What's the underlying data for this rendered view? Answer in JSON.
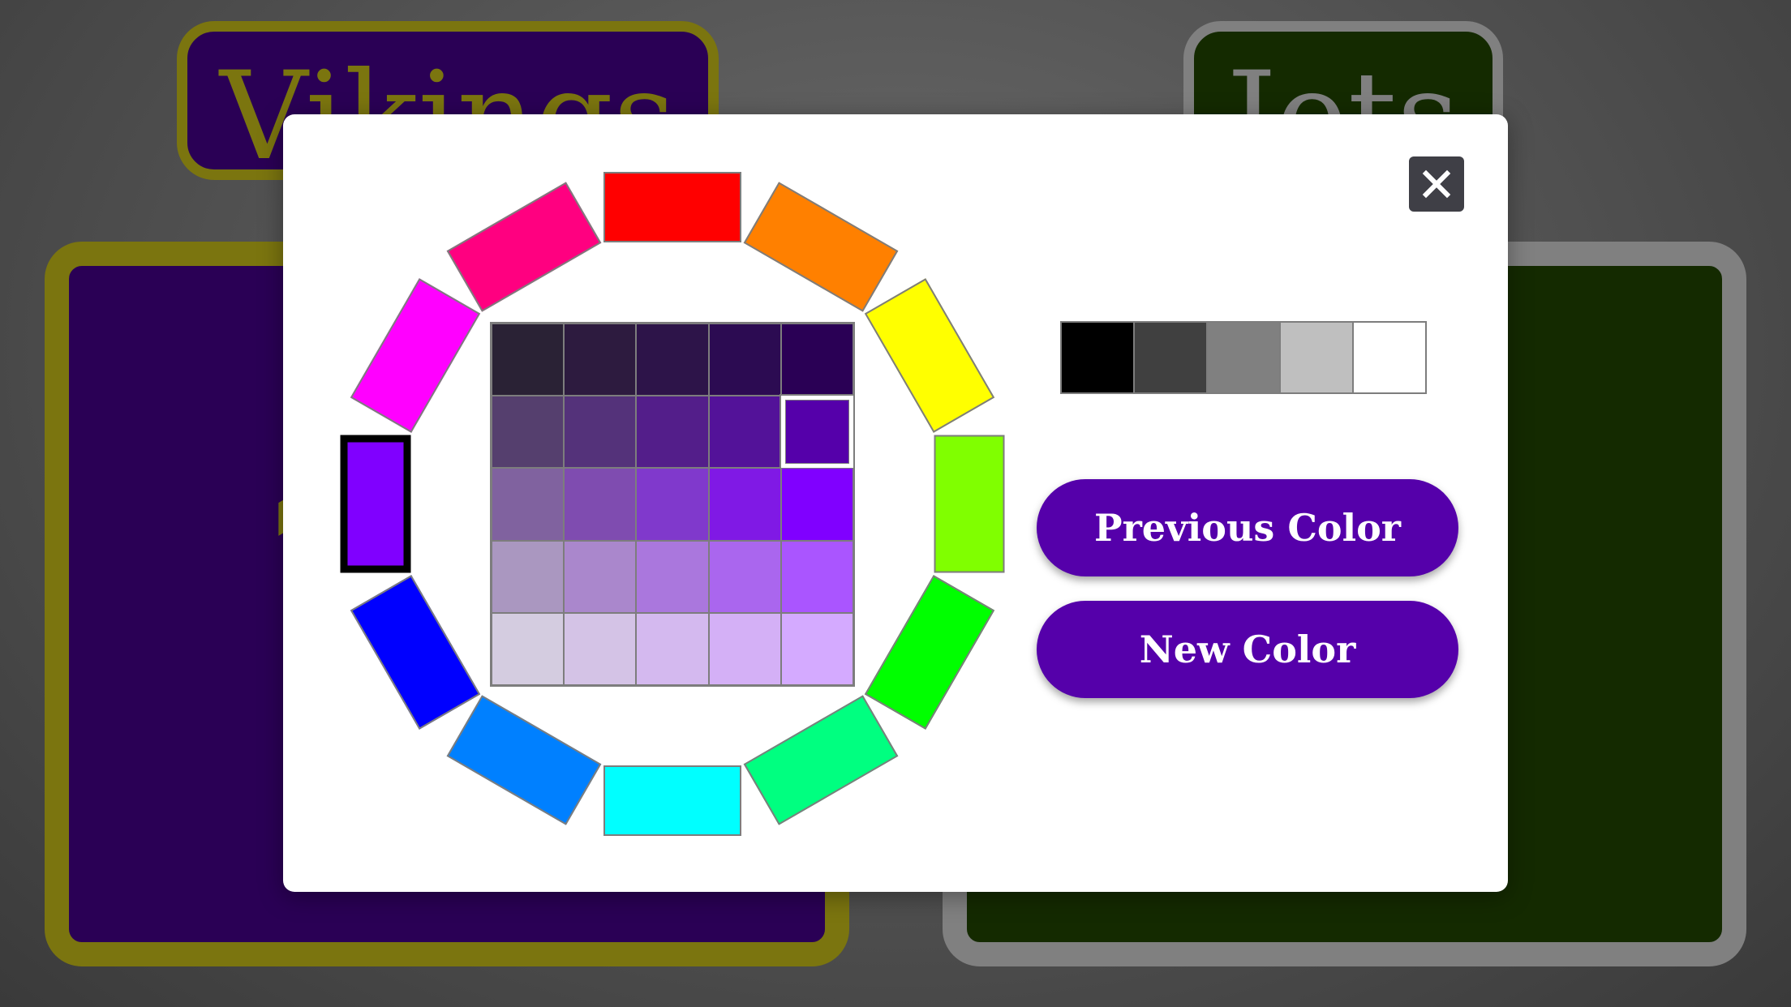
{
  "teams": {
    "home": {
      "name": "Vikings",
      "score": "1",
      "background": "#2a0055",
      "accent": "#7b750f"
    },
    "away": {
      "name": "Jets",
      "score": "",
      "background": "#142a00",
      "accent": "#808080"
    }
  },
  "picker": {
    "close_icon": "close-icon",
    "wheel_colors": [
      "#ff0000",
      "#ff8000",
      "#ffff00",
      "#80ff00",
      "#00ff00",
      "#00ff80",
      "#00ffff",
      "#0080ff",
      "#0000ff",
      "#8000ff",
      "#ff00ff",
      "#ff0080"
    ],
    "wheel_selected": "#8000ff",
    "shades": [
      [
        "#2a2235",
        "#2d1b3f",
        "#2d1449",
        "#2c0b52",
        "#2a0055"
      ],
      [
        "#553f6e",
        "#54327a",
        "#531e8a",
        "#531299",
        "#5500aa"
      ],
      [
        "#80629f",
        "#7f4cb0",
        "#8039cc",
        "#8019e5",
        "#8000ff"
      ],
      [
        "#aa97c0",
        "#aa87cc",
        "#aa77dd",
        "#aa66ee",
        "#aa55ff"
      ],
      [
        "#d4cce0",
        "#d4c3e6",
        "#d4b9ef",
        "#d4b0f6",
        "#d4aaff"
      ]
    ],
    "shade_selected": "#5500aa",
    "grays": [
      "#000000",
      "#404040",
      "#808080",
      "#bfbfbf",
      "#ffffff"
    ],
    "previous_label": "Previous Color",
    "new_label": "New Color",
    "button_color": "#5500aa"
  }
}
